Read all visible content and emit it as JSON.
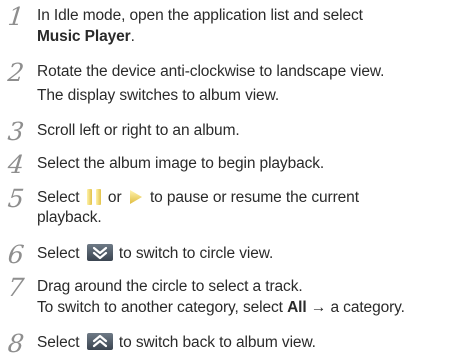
{
  "steps": [
    {
      "number": "1",
      "lines": {
        "a": "In Idle mode, open the application list and select",
        "b": "Music Player",
        "b_suffix": "."
      }
    },
    {
      "number": "2",
      "lines": {
        "a": "Rotate the device anti-clockwise to landscape view.",
        "b": "The display switches to album view."
      }
    },
    {
      "number": "3",
      "lines": {
        "a": "Scroll left or right to an album."
      }
    },
    {
      "number": "4",
      "lines": {
        "a": "Select the album image to begin playback."
      }
    },
    {
      "number": "5",
      "lines": {
        "a_pre": "Select",
        "a_mid": "or",
        "a_post": "to pause or resume the current",
        "b": "playback."
      },
      "icons": [
        "pause-icon",
        "play-icon"
      ]
    },
    {
      "number": "6",
      "lines": {
        "a_pre": "Select",
        "a_post": "to switch to circle view."
      },
      "icons": [
        "chevron-down-icon"
      ]
    },
    {
      "number": "7",
      "lines": {
        "a": "Drag around the circle to select a track.",
        "b_pre": "To switch to another category, select",
        "b_bold": "All",
        "b_arrow": "→",
        "b_post": "a category."
      }
    },
    {
      "number": "8",
      "lines": {
        "a_pre": "Select",
        "a_post": "to switch back to album view."
      },
      "icons": [
        "chevron-up-icon"
      ]
    }
  ]
}
